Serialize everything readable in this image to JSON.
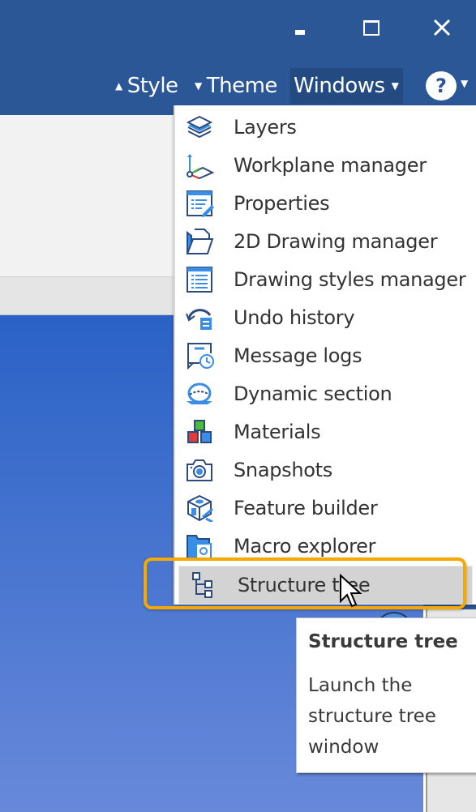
{
  "window_controls": {
    "minimize": "minimize",
    "maximize": "maximize",
    "close": "close"
  },
  "ribbon": {
    "tabs": [
      {
        "label": "Style",
        "caret": "▲"
      },
      {
        "label": "Theme",
        "caret": "▼"
      },
      {
        "label": "Windows",
        "caret": "▼",
        "active": true
      }
    ],
    "help_label": "?",
    "help_caret": "▼"
  },
  "windows_menu": {
    "items": [
      {
        "label": "Layers",
        "icon": "layers-icon"
      },
      {
        "label": "Workplane manager",
        "icon": "workplane-icon"
      },
      {
        "label": "Properties",
        "icon": "properties-icon"
      },
      {
        "label": "2D Drawing manager",
        "icon": "drawing-folder-icon"
      },
      {
        "label": "Drawing styles manager",
        "icon": "list-window-icon"
      },
      {
        "label": "Undo history",
        "icon": "undo-history-icon"
      },
      {
        "label": "Message logs",
        "icon": "message-log-icon"
      },
      {
        "label": "Dynamic section",
        "icon": "dynamic-section-icon"
      },
      {
        "label": "Materials",
        "icon": "materials-icon"
      },
      {
        "label": "Snapshots",
        "icon": "camera-icon"
      },
      {
        "label": "Feature builder",
        "icon": "feature-builder-icon"
      },
      {
        "label": "Macro explorer",
        "icon": "macro-folder-icon"
      },
      {
        "label": "Structure tree",
        "icon": "structure-tree-icon",
        "highlighted": true
      }
    ]
  },
  "tooltip": {
    "title": "Structure tree",
    "body": "Launch the structure tree window"
  },
  "colors": {
    "titlebar": "#2b5797",
    "highlight_ring": "#f5a800",
    "icon_dark": "#2d4a7c",
    "icon_light": "#3b8ee8"
  }
}
